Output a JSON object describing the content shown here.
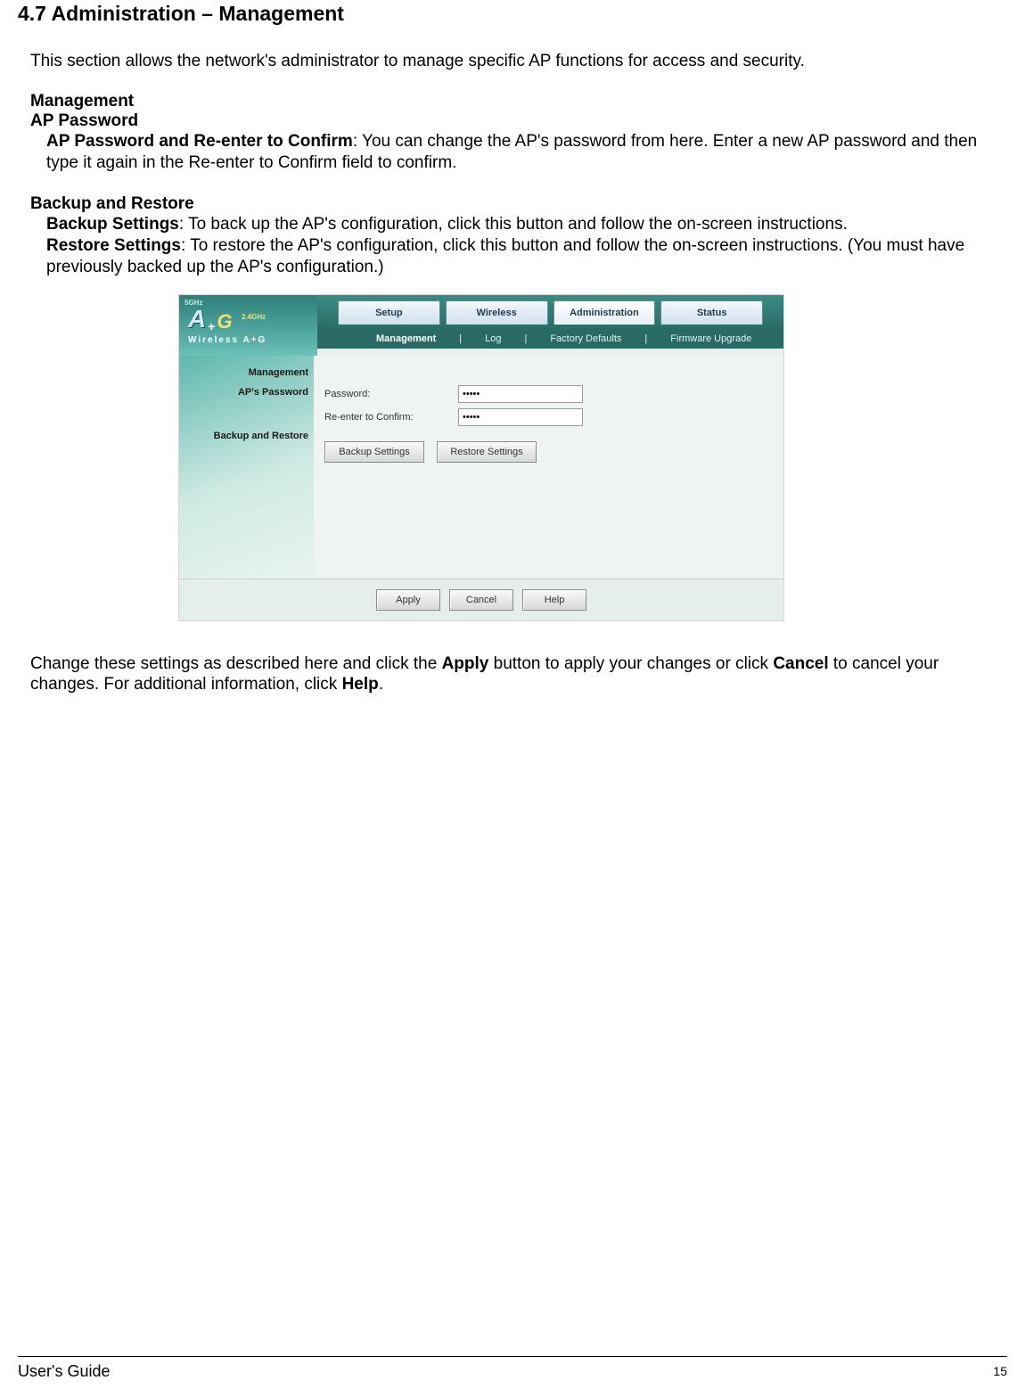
{
  "doc": {
    "section_title": "4.7 Administration – Management",
    "intro": "This section allows the network's administrator to manage specific AP functions for access and security.",
    "management_heading": "Management",
    "ap_password_heading": "AP Password",
    "ap_password_label": "AP Password and Re-enter to Confirm",
    "ap_password_desc": ": You can change the AP's password from here. Enter a new AP password and then type it again in the Re-enter to Confirm field to confirm.",
    "backup_restore_heading": "Backup and Restore",
    "backup_label": "Backup Settings",
    "backup_desc": ": To back up the AP's configuration, click this button and follow the on-screen instructions.",
    "restore_label": "Restore Settings",
    "restore_desc": ": To restore the AP's configuration, click this button and follow the on-screen instructions. (You must have previously backed up the AP's configuration.)",
    "closing_pre": "Change these settings as described here and click the ",
    "closing_apply": "Apply",
    "closing_mid": " button to apply your changes or click ",
    "closing_cancel": "Cancel",
    "closing_post1": " to cancel your changes. For additional information, click ",
    "closing_help": "Help",
    "closing_end": ".",
    "footer_left": "User's Guide",
    "footer_page": "15"
  },
  "ui": {
    "logo": {
      "tag1": "5GHz",
      "tag2": "2.4GHz",
      "big_a": "A",
      "plus": "+",
      "g": "G",
      "sub": "Wireless A+G"
    },
    "nav": {
      "tabs": [
        "Setup",
        "Wireless",
        "Administration",
        "Status"
      ],
      "active_index": 2
    },
    "subnav": {
      "items": [
        "Management",
        "Log",
        "Factory Defaults",
        "Firmware Upgrade"
      ],
      "active_index": 0
    },
    "side": {
      "management": "Management",
      "aps_password": "AP's Password",
      "backup_restore": "Backup and Restore"
    },
    "form": {
      "password_label": "Password:",
      "password_value": "•••••",
      "confirm_label": "Re-enter to Confirm:",
      "confirm_value": "•••••",
      "backup_btn": "Backup Settings",
      "restore_btn": "Restore Settings"
    },
    "footer": {
      "apply": "Apply",
      "cancel": "Cancel",
      "help": "Help"
    }
  }
}
